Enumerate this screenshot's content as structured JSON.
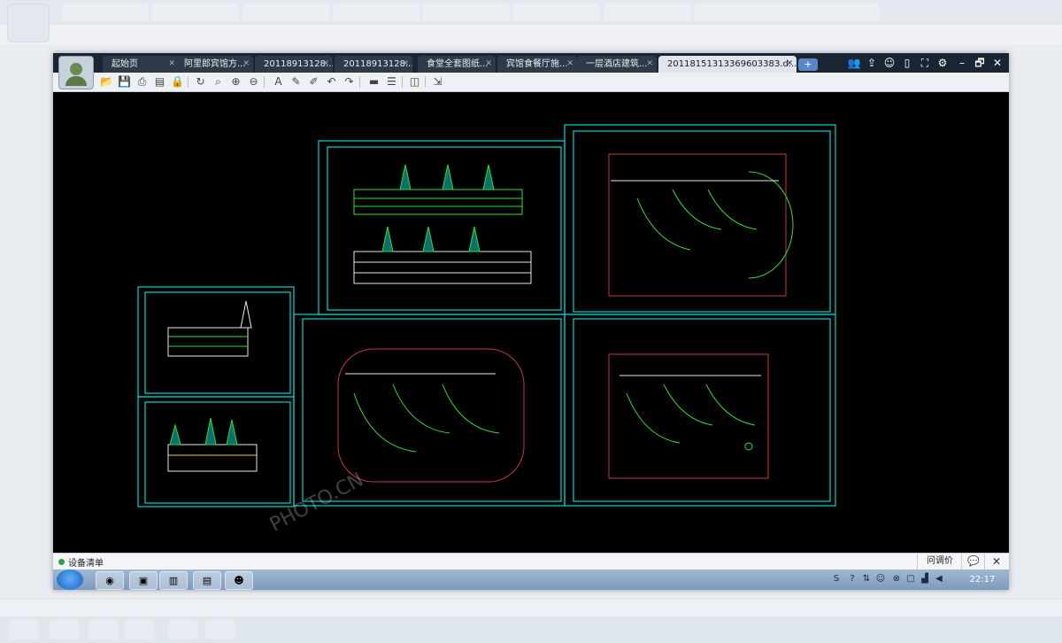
{
  "tabs": [
    {
      "label": "起始页"
    },
    {
      "label": "阿里郎宾馆方..."
    },
    {
      "label": "20118913128..."
    },
    {
      "label": "20118913128..."
    },
    {
      "label": "食堂全套图纸..."
    },
    {
      "label": "宾馆食餐厅施..."
    },
    {
      "label": "一层酒店建筑..."
    },
    {
      "label": "2011815131336960338З.d..."
    }
  ],
  "new_tab_label": "+",
  "window_controls": {
    "minimize": "–",
    "restore": "🗗",
    "close": "✕"
  },
  "toolbar_icons": [
    "open-icon",
    "save-icon",
    "print-icon",
    "pdf-icon",
    "lock-icon",
    "rotate-icon",
    "zoom-window-icon",
    "zoom-in-icon",
    "zoom-out-icon",
    "text-icon",
    "pencil-icon",
    "highlighter-icon",
    "undo-icon",
    "redo-icon",
    "measure-icon",
    "measure-area-icon",
    "layers-icon",
    "export-icon"
  ],
  "status": {
    "label": "设备清单",
    "mode": "问调价",
    "chat_glyph": "💬",
    "close_glyph": "✕"
  },
  "taskbar": {
    "clock": "22:17"
  },
  "watermark": "PHOTO.CN",
  "colors": {
    "canvas": "#000000",
    "frame": "#00d7d0",
    "drawing_green": "#2fe02f",
    "drawing_red": "#c83a3a",
    "drawing_white": "#e8e8e8"
  }
}
